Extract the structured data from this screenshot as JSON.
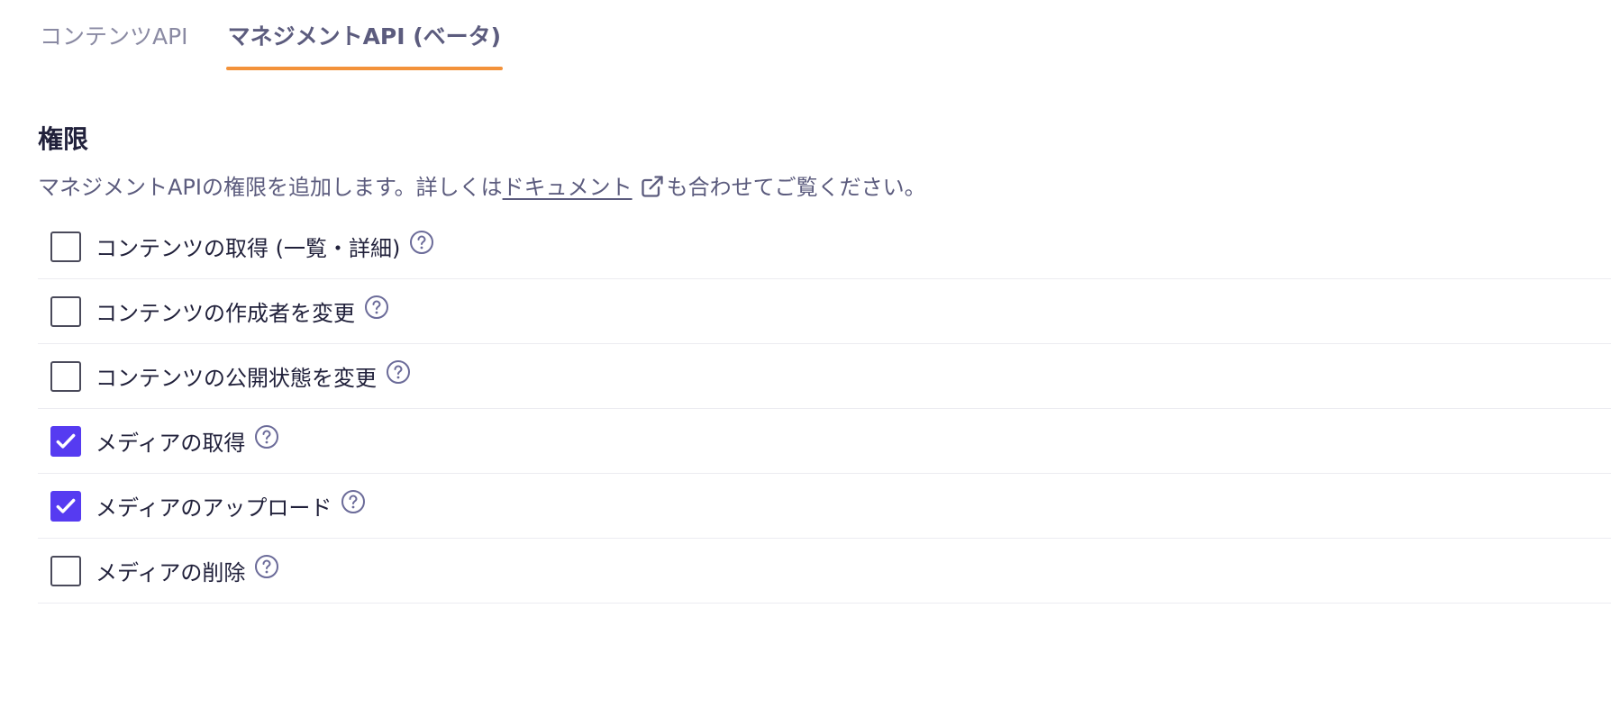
{
  "tabs": [
    {
      "label": "コンテンツAPI",
      "active": false
    },
    {
      "label": "マネジメントAPI (ベータ)",
      "active": true
    }
  ],
  "permissions_section": {
    "title": "権限",
    "description_before": "マネジメントAPIの権限を追加します。詳しくは",
    "doc_link_label": "ドキュメント",
    "description_after": "も合わせてご覧ください。",
    "items": [
      {
        "label": "コンテンツの取得 (一覧・詳細)",
        "checked": false
      },
      {
        "label": "コンテンツの作成者を変更",
        "checked": false
      },
      {
        "label": "コンテンツの公開状態を変更",
        "checked": false
      },
      {
        "label": "メディアの取得",
        "checked": true
      },
      {
        "label": "メディアのアップロード",
        "checked": true
      },
      {
        "label": "メディアの削除",
        "checked": false
      }
    ]
  },
  "icons": {
    "help": "question-circle-icon",
    "external_link": "external-link-icon",
    "check": "checkmark-icon"
  },
  "colors": {
    "accent_tab_underline": "#f3923a",
    "checkbox_checked": "#563bf1",
    "muted_text": "#5c5c7e",
    "help_icon": "#6b6b99"
  }
}
